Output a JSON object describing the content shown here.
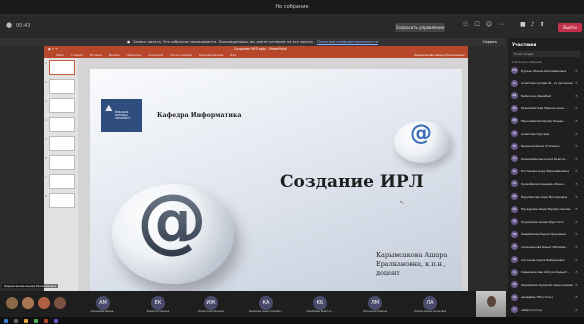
{
  "window": {
    "title": "Но собрание"
  },
  "toolbar": {
    "timer": "00:43",
    "control_button": "Запросить управление",
    "leave_button": "Выйти",
    "accent": "#c4314b"
  },
  "notice": {
    "text": "Запись начата. Это собрание записывается. Присоединяясь, вы даете согласие на его запись.",
    "link": "Политика конфиденциальности",
    "hide": "Скрыть"
  },
  "powerpoint": {
    "doc_title": "Создание ИРЛ.pptx - PowerPoint",
    "user": "Карымсакова Ашара Ералкановна",
    "tabs": [
      "Файл",
      "Главная",
      "Вставка",
      "Дизайн",
      "Переходы",
      "Анимация",
      "Показ слайдов",
      "Рецензирование",
      "Вид"
    ],
    "thumbnails": [
      "1",
      "2",
      "3",
      "4",
      "5",
      "6",
      "7",
      "8"
    ],
    "brand_color": "#b7472a"
  },
  "slide": {
    "logo_text": "EURASIAN NATIONAL UNIVERSITY",
    "department": "Кафедра Информатика",
    "title": "Создание ИРЛ",
    "author_line1": "Карымсакова Ашара",
    "author_line2": "Ералкановна, к.п.н., доцент"
  },
  "panel": {
    "title": "Участники",
    "search_placeholder": "Поиск людей",
    "section": "Участники собрания",
    "participants": [
      {
        "initials": "НЖ",
        "name": "Нуркен Жанар Бирлибековна"
      },
      {
        "initials": "АС",
        "name": "Ахметова Сулава Ж.. (в организации)"
      },
      {
        "initials": "БД",
        "name": "Байкожин Дамибай"
      },
      {
        "initials": "ЕМ",
        "name": "Еремимбетова Марина Асан..."
      },
      {
        "initials": "ММ",
        "name": "Мангыбекова Мулар Кашар..."
      },
      {
        "initials": "АН",
        "name": "Ахметова Нурсара"
      },
      {
        "initials": "ЕУ",
        "name": "Бримина Белек Утепович"
      },
      {
        "initials": "КА",
        "name": "Кармамбекова Азиза Бракта..."
      },
      {
        "initials": "КА",
        "name": "Костенова Анар Жанкабековна"
      },
      {
        "initials": "КА",
        "name": "Кузекбеков Анширан Жани..."
      },
      {
        "initials": "МА",
        "name": "Мурубекова Аида Мухтаровна"
      },
      {
        "initials": "МА",
        "name": "Мусаурова Айым Жумарстанова"
      },
      {
        "initials": "НА",
        "name": "Нурдилова Асема Мурстата"
      },
      {
        "initials": "ОБ",
        "name": "Омарбекова Бурия Орысевна"
      },
      {
        "initials": "СЕ",
        "name": "Сагандыкова Бакыт Ибтарбе..."
      },
      {
        "initials": "СБ",
        "name": "Сатчанов Серик Байрамович"
      },
      {
        "initials": "СА",
        "name": "Садыкакасова Айгуль Кадырт..."
      },
      {
        "initials": "ОК",
        "name": "Оминбеков Куралай Сериккалиев"
      },
      {
        "initials": "АК",
        "name": "ахмадбек НФ (гость)"
      },
      {
        "initials": "СГ",
        "name": "сайфи (гость)"
      }
    ]
  },
  "stage": {
    "presenter_label": "Карымсакова Ашара Ералкановна",
    "tiles": [
      {
        "initials": "АМ",
        "name": "Ахмадиева Мырза..."
      },
      {
        "initials": "ЕК",
        "name": "Ерекен Кужарина"
      },
      {
        "initials": "ИЖ",
        "name": "Исмагулова Жанара"
      },
      {
        "initials": "КА",
        "name": "Каримова Анара Оразбек..."
      },
      {
        "initials": "КБ",
        "name": "Карабаева Брайгул..."
      },
      {
        "initials": "ЛМ",
        "name": "Лукпанова Мадина"
      },
      {
        "initials": "ЛА",
        "name": "Лубова Айжан Арсеновна"
      }
    ]
  }
}
